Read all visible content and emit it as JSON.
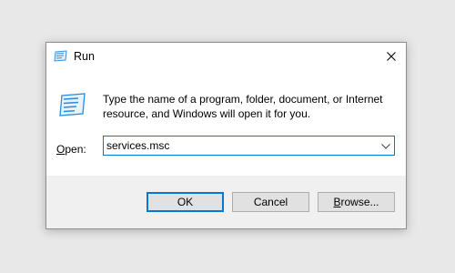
{
  "window": {
    "title": "Run",
    "icon": "run-app-icon",
    "close_icon": "close-icon"
  },
  "content": {
    "description": "Type the name of a program, folder, document, or Internet resource, and Windows will open it for you.",
    "open_label_mnemonic": "O",
    "open_label_rest": "pen:",
    "open_value": "services.msc"
  },
  "buttons": {
    "ok": "OK",
    "cancel": "Cancel",
    "browse_mnemonic": "B",
    "browse_rest": "rowse..."
  },
  "colors": {
    "focus_accent": "#0078d7",
    "dialog_face": "#f0f0f0",
    "button_face": "#e1e1e1"
  }
}
